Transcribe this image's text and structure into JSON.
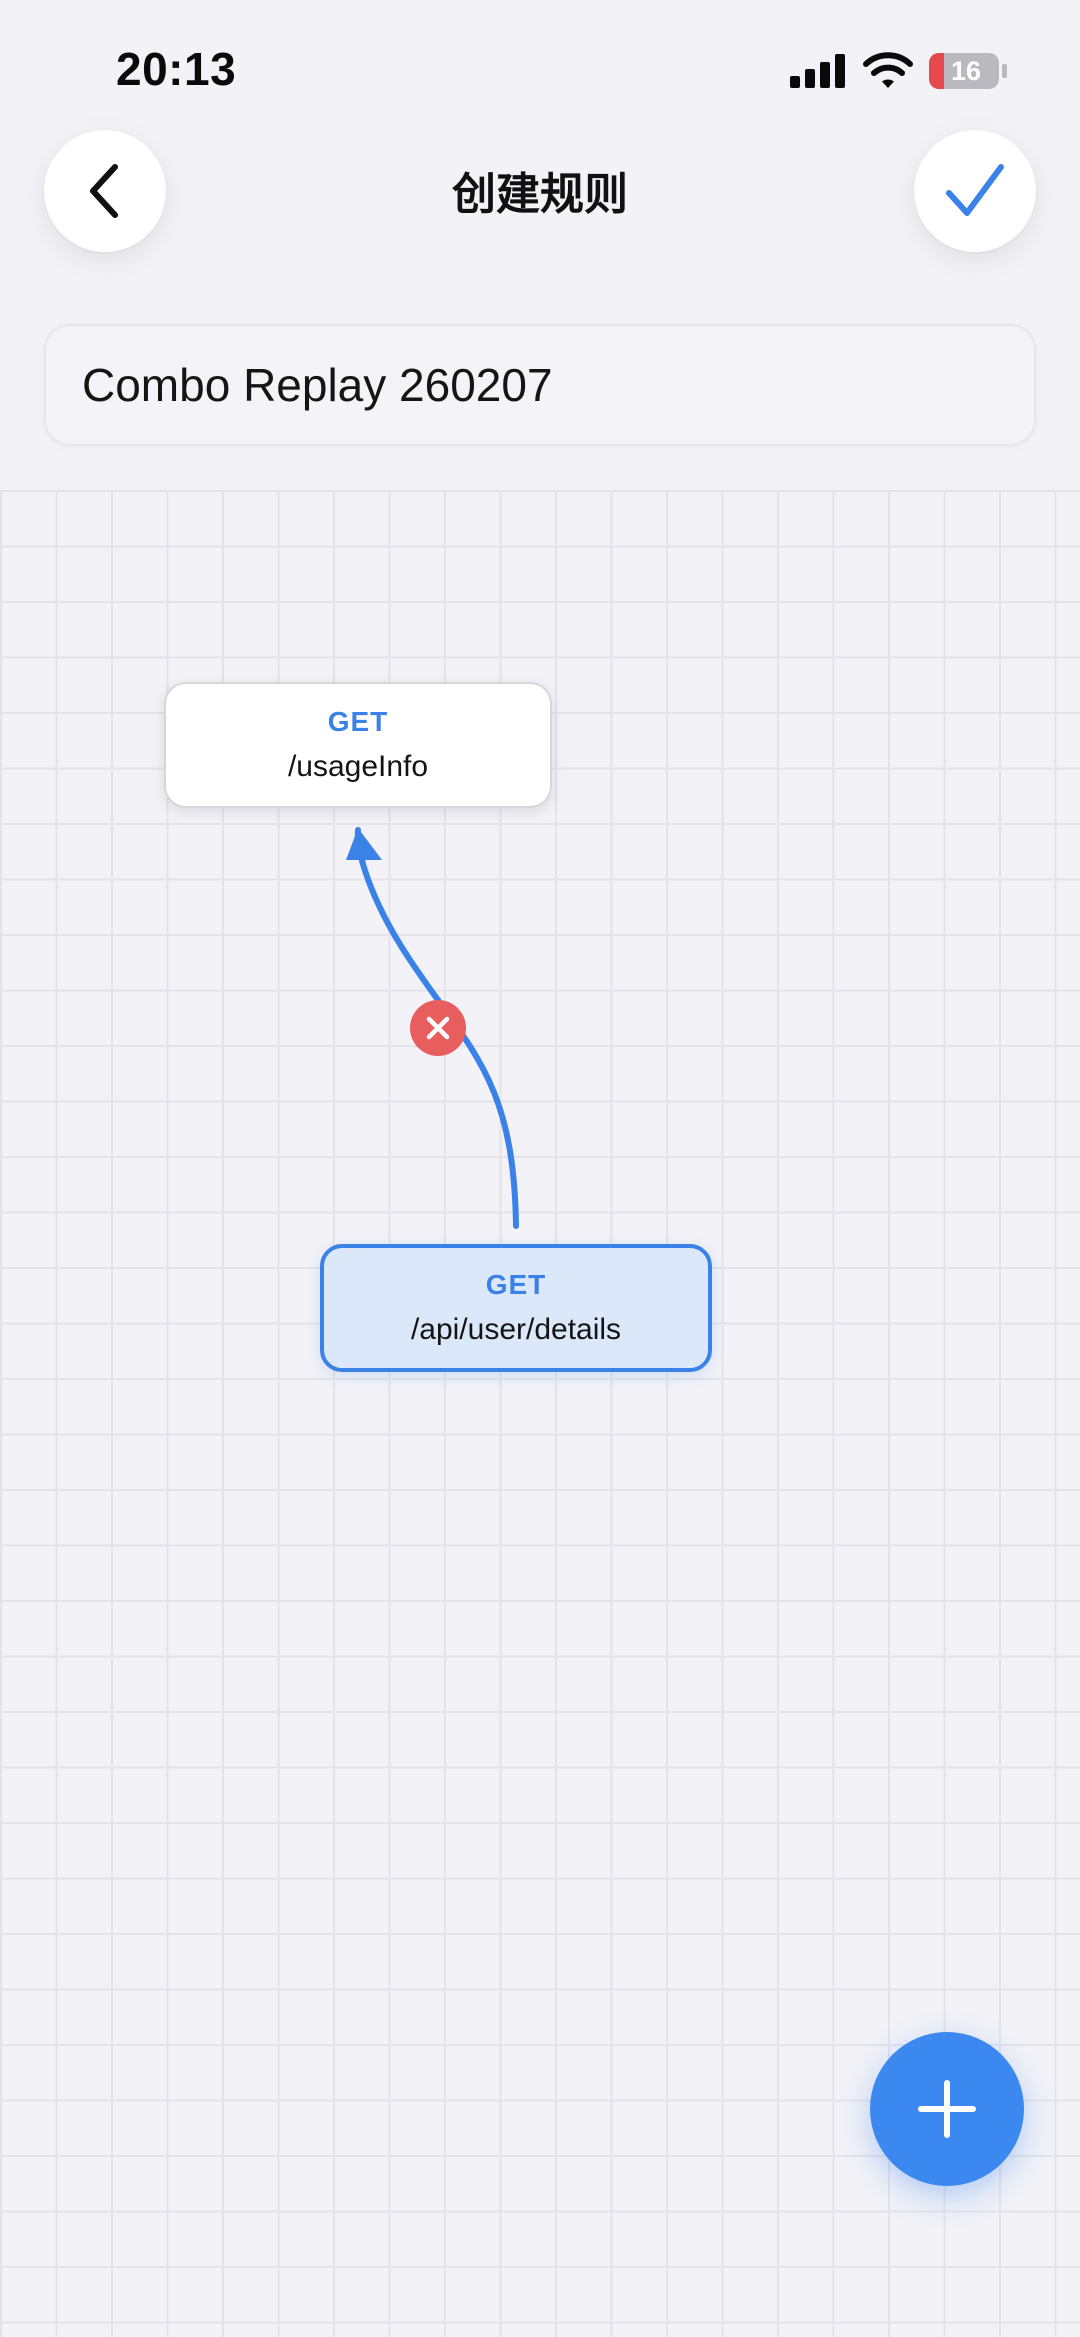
{
  "status_bar": {
    "time": "20:13",
    "battery_level": "16",
    "icons": [
      "signal-icon",
      "wifi-icon",
      "battery-icon"
    ]
  },
  "nav": {
    "title": "创建规则",
    "back_icon": "chevron-left-icon",
    "confirm_icon": "checkmark-icon"
  },
  "rule": {
    "name": "Combo Replay 260207"
  },
  "canvas": {
    "nodes": [
      {
        "method": "GET",
        "path": "/usageInfo"
      },
      {
        "method": "GET",
        "path": "/api/user/details",
        "selected": true
      }
    ],
    "edges": [
      {
        "from": "/api/user/details",
        "to": "/usageInfo",
        "delete_icon": "close-icon"
      }
    ]
  },
  "fab": {
    "icon": "plus-icon"
  },
  "colors": {
    "accent": "#3b82e8",
    "danger": "#e85d5d",
    "background": "#f2f2f7",
    "battery_low": "#e5484d"
  }
}
